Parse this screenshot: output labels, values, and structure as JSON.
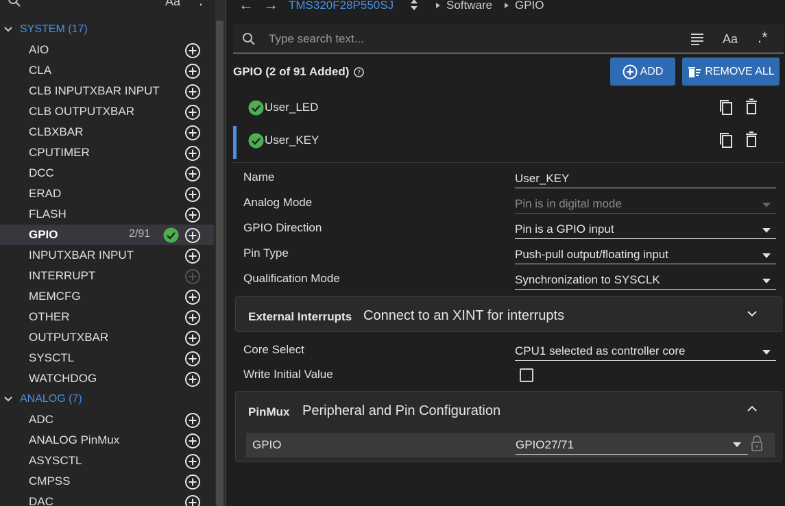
{
  "sidebar": {
    "search_icon": "search-icon",
    "case_label": "Aa",
    "regex_label": ".*",
    "categories": [
      {
        "label": "SYSTEM (17)",
        "expanded": true
      },
      {
        "label": "ANALOG (7)",
        "expanded": true
      }
    ],
    "system_items": [
      {
        "label": "AIO"
      },
      {
        "label": "CLA"
      },
      {
        "label": "CLB INPUTXBAR INPUT"
      },
      {
        "label": "CLB OUTPUTXBAR"
      },
      {
        "label": "CLBXBAR"
      },
      {
        "label": "CPUTIMER"
      },
      {
        "label": "DCC"
      },
      {
        "label": "ERAD"
      },
      {
        "label": "FLASH"
      },
      {
        "label": "GPIO",
        "count": "2/91",
        "selected": true,
        "configured": true
      },
      {
        "label": "INPUTXBAR INPUT"
      },
      {
        "label": "INTERRUPT",
        "disabled": true
      },
      {
        "label": "MEMCFG"
      },
      {
        "label": "OTHER"
      },
      {
        "label": "OUTPUTXBAR"
      },
      {
        "label": "SYSCTL"
      },
      {
        "label": "WATCHDOG"
      }
    ],
    "analog_items": [
      {
        "label": "ADC"
      },
      {
        "label": "ANALOG PinMux"
      },
      {
        "label": "ASYSCTL"
      },
      {
        "label": "CMPSS"
      },
      {
        "label": "DAC"
      }
    ]
  },
  "header": {
    "device": "TMS320F28P550SJ",
    "breadcrumb": [
      "Software",
      "GPIO"
    ]
  },
  "search": {
    "placeholder": "Type search text...",
    "case_label": "Aa",
    "regex_label": ".*"
  },
  "module": {
    "title": "GPIO (2 of 91 Added)",
    "add_label": "ADD",
    "remove_all_label": "REMOVE ALL",
    "instances": [
      {
        "name": "User_LED",
        "selected": false
      },
      {
        "name": "User_KEY",
        "selected": true
      }
    ]
  },
  "config": {
    "rows_top": [
      {
        "key": "Name",
        "value": "User_KEY",
        "dropdown": false,
        "disabled": false
      },
      {
        "key": "Analog Mode",
        "value": "Pin is in digital mode",
        "dropdown": true,
        "disabled": true
      },
      {
        "key": "GPIO Direction",
        "value": "Pin is a GPIO input",
        "dropdown": true,
        "disabled": false
      },
      {
        "key": "Pin Type",
        "value": "Push-pull output/floating input",
        "dropdown": true,
        "disabled": false
      },
      {
        "key": "Qualification Mode",
        "value": "Synchronization to SYSCLK",
        "dropdown": true,
        "disabled": false
      }
    ],
    "ext_int": {
      "title": "External Interrupts",
      "desc": "Connect to an XINT for interrupts",
      "expanded": false
    },
    "rows_mid": [
      {
        "key": "Core Select",
        "value": "CPU1 selected as controller core",
        "dropdown": true
      },
      {
        "key": "Write Initial Value",
        "checked": false
      }
    ],
    "pinmux": {
      "title": "PinMux",
      "desc": "Peripheral and Pin Configuration",
      "expanded": true,
      "row_key": "GPIO",
      "row_value": "GPIO27/71"
    }
  },
  "colors": {
    "accent": "#4a90e2",
    "button": "#2e6bb2",
    "ok": "#4caf50",
    "background": "#1f1f1f"
  }
}
